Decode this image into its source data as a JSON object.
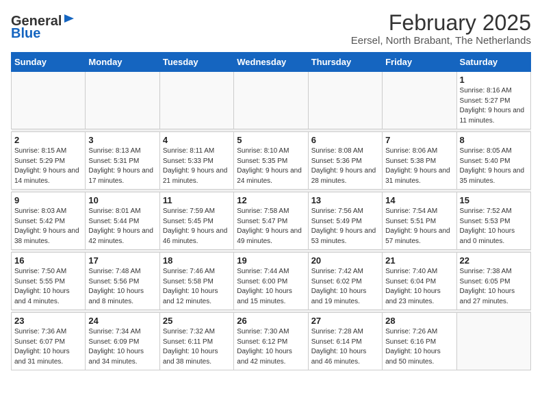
{
  "header": {
    "logo_general": "General",
    "logo_blue": "Blue",
    "title": "February 2025",
    "subtitle": "Eersel, North Brabant, The Netherlands"
  },
  "weekdays": [
    "Sunday",
    "Monday",
    "Tuesday",
    "Wednesday",
    "Thursday",
    "Friday",
    "Saturday"
  ],
  "weeks": [
    [
      {
        "day": "",
        "info": ""
      },
      {
        "day": "",
        "info": ""
      },
      {
        "day": "",
        "info": ""
      },
      {
        "day": "",
        "info": ""
      },
      {
        "day": "",
        "info": ""
      },
      {
        "day": "",
        "info": ""
      },
      {
        "day": "1",
        "info": "Sunrise: 8:16 AM\nSunset: 5:27 PM\nDaylight: 9 hours and 11 minutes."
      }
    ],
    [
      {
        "day": "2",
        "info": "Sunrise: 8:15 AM\nSunset: 5:29 PM\nDaylight: 9 hours and 14 minutes."
      },
      {
        "day": "3",
        "info": "Sunrise: 8:13 AM\nSunset: 5:31 PM\nDaylight: 9 hours and 17 minutes."
      },
      {
        "day": "4",
        "info": "Sunrise: 8:11 AM\nSunset: 5:33 PM\nDaylight: 9 hours and 21 minutes."
      },
      {
        "day": "5",
        "info": "Sunrise: 8:10 AM\nSunset: 5:35 PM\nDaylight: 9 hours and 24 minutes."
      },
      {
        "day": "6",
        "info": "Sunrise: 8:08 AM\nSunset: 5:36 PM\nDaylight: 9 hours and 28 minutes."
      },
      {
        "day": "7",
        "info": "Sunrise: 8:06 AM\nSunset: 5:38 PM\nDaylight: 9 hours and 31 minutes."
      },
      {
        "day": "8",
        "info": "Sunrise: 8:05 AM\nSunset: 5:40 PM\nDaylight: 9 hours and 35 minutes."
      }
    ],
    [
      {
        "day": "9",
        "info": "Sunrise: 8:03 AM\nSunset: 5:42 PM\nDaylight: 9 hours and 38 minutes."
      },
      {
        "day": "10",
        "info": "Sunrise: 8:01 AM\nSunset: 5:44 PM\nDaylight: 9 hours and 42 minutes."
      },
      {
        "day": "11",
        "info": "Sunrise: 7:59 AM\nSunset: 5:45 PM\nDaylight: 9 hours and 46 minutes."
      },
      {
        "day": "12",
        "info": "Sunrise: 7:58 AM\nSunset: 5:47 PM\nDaylight: 9 hours and 49 minutes."
      },
      {
        "day": "13",
        "info": "Sunrise: 7:56 AM\nSunset: 5:49 PM\nDaylight: 9 hours and 53 minutes."
      },
      {
        "day": "14",
        "info": "Sunrise: 7:54 AM\nSunset: 5:51 PM\nDaylight: 9 hours and 57 minutes."
      },
      {
        "day": "15",
        "info": "Sunrise: 7:52 AM\nSunset: 5:53 PM\nDaylight: 10 hours and 0 minutes."
      }
    ],
    [
      {
        "day": "16",
        "info": "Sunrise: 7:50 AM\nSunset: 5:55 PM\nDaylight: 10 hours and 4 minutes."
      },
      {
        "day": "17",
        "info": "Sunrise: 7:48 AM\nSunset: 5:56 PM\nDaylight: 10 hours and 8 minutes."
      },
      {
        "day": "18",
        "info": "Sunrise: 7:46 AM\nSunset: 5:58 PM\nDaylight: 10 hours and 12 minutes."
      },
      {
        "day": "19",
        "info": "Sunrise: 7:44 AM\nSunset: 6:00 PM\nDaylight: 10 hours and 15 minutes."
      },
      {
        "day": "20",
        "info": "Sunrise: 7:42 AM\nSunset: 6:02 PM\nDaylight: 10 hours and 19 minutes."
      },
      {
        "day": "21",
        "info": "Sunrise: 7:40 AM\nSunset: 6:04 PM\nDaylight: 10 hours and 23 minutes."
      },
      {
        "day": "22",
        "info": "Sunrise: 7:38 AM\nSunset: 6:05 PM\nDaylight: 10 hours and 27 minutes."
      }
    ],
    [
      {
        "day": "23",
        "info": "Sunrise: 7:36 AM\nSunset: 6:07 PM\nDaylight: 10 hours and 31 minutes."
      },
      {
        "day": "24",
        "info": "Sunrise: 7:34 AM\nSunset: 6:09 PM\nDaylight: 10 hours and 34 minutes."
      },
      {
        "day": "25",
        "info": "Sunrise: 7:32 AM\nSunset: 6:11 PM\nDaylight: 10 hours and 38 minutes."
      },
      {
        "day": "26",
        "info": "Sunrise: 7:30 AM\nSunset: 6:12 PM\nDaylight: 10 hours and 42 minutes."
      },
      {
        "day": "27",
        "info": "Sunrise: 7:28 AM\nSunset: 6:14 PM\nDaylight: 10 hours and 46 minutes."
      },
      {
        "day": "28",
        "info": "Sunrise: 7:26 AM\nSunset: 6:16 PM\nDaylight: 10 hours and 50 minutes."
      },
      {
        "day": "",
        "info": ""
      }
    ]
  ]
}
